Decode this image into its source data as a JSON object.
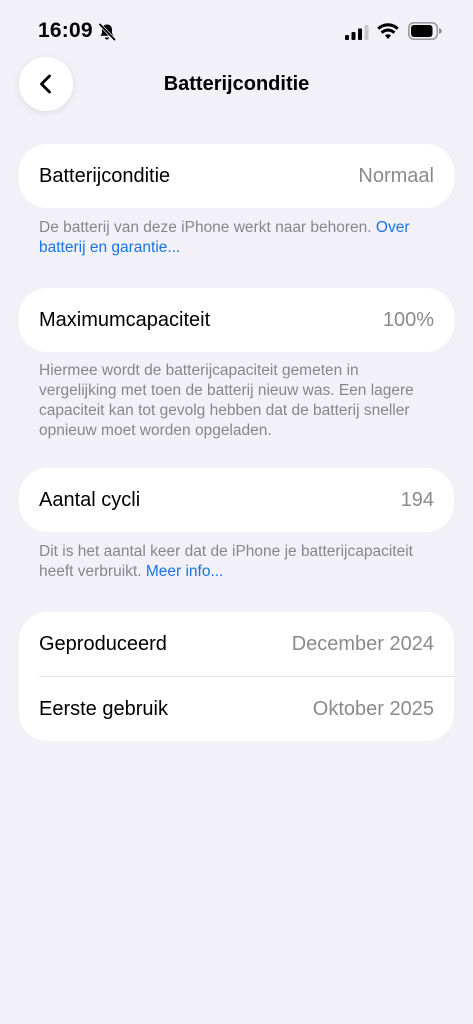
{
  "status_bar": {
    "time": "16:09"
  },
  "nav": {
    "title": "Batterijconditie"
  },
  "sections": {
    "condition": {
      "label": "Batterijconditie",
      "value": "Normaal",
      "footnote_text": "De batterij van deze iPhone werkt naar behoren. ",
      "footnote_link": "Over batterij en garantie..."
    },
    "capacity": {
      "label": "Maximumcapaciteit",
      "value": "100%",
      "footnote_text": "Hiermee wordt de batterijcapaciteit gemeten in vergelijking met toen de batterij nieuw was. Een lagere capaciteit kan tot gevolg hebben dat de batterij sneller opnieuw moet worden opgeladen."
    },
    "cycles": {
      "label": "Aantal cycli",
      "value": "194",
      "footnote_text": "Dit is het aantal keer dat de iPhone je batterijcapaciteit heeft verbruikt. ",
      "footnote_link": "Meer info..."
    },
    "dates": {
      "manufactured_label": "Geproduceerd",
      "manufactured_value": "December 2024",
      "first_use_label": "Eerste gebruik",
      "first_use_value": "Oktober 2025"
    }
  },
  "icons": {
    "bell": "bell-slash-icon",
    "signal": "cellular-signal-icon",
    "wifi": "wifi-icon",
    "battery": "battery-icon",
    "back": "chevron-left-icon"
  },
  "colors": {
    "background": "#f2f1f7",
    "link": "#1a73e8",
    "secondary_text": "#8a8a8e"
  }
}
